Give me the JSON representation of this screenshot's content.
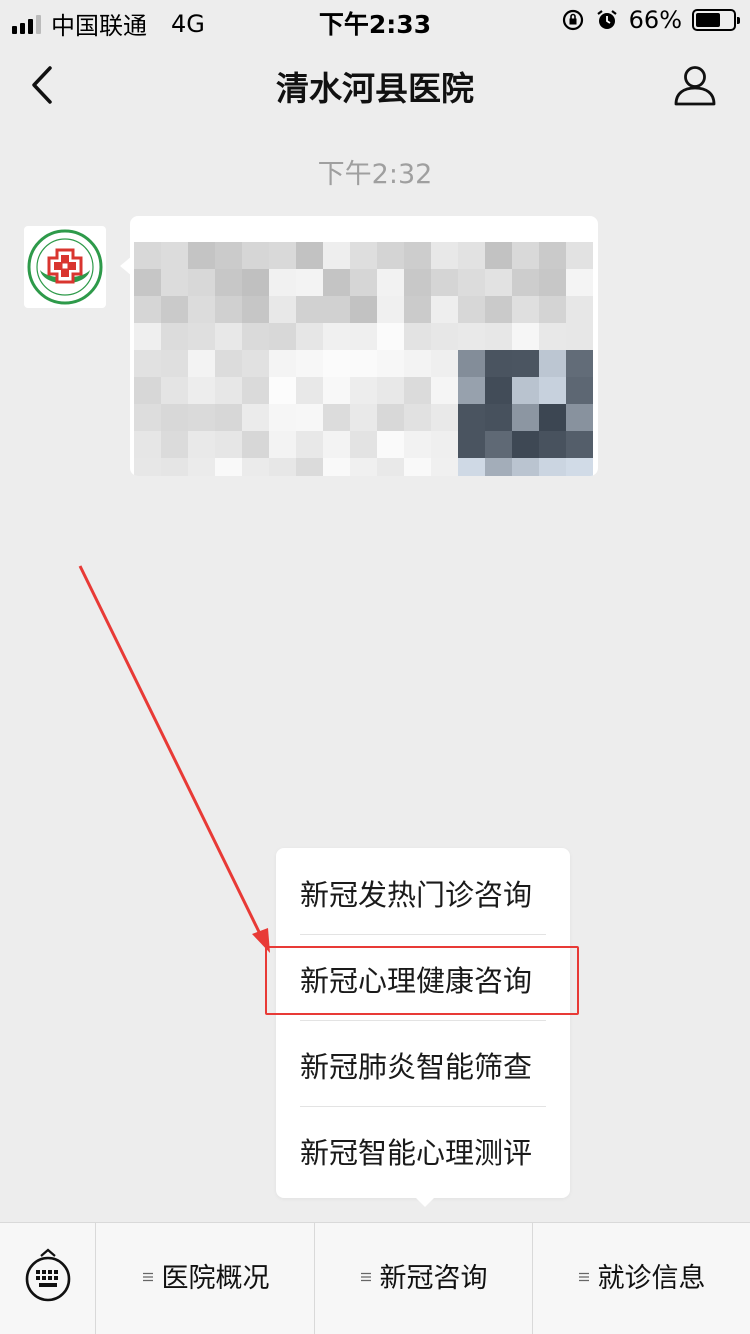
{
  "status_bar": {
    "carrier": "中国联通",
    "network": "4G",
    "time": "下午2:33",
    "battery_percent": "66%",
    "battery_level": 0.66
  },
  "nav": {
    "title": "清水河县医院",
    "back_icon": "chevron-left-icon",
    "profile_icon": "person-icon"
  },
  "chat": {
    "timestamp": "下午2:32"
  },
  "submenu": {
    "items": [
      {
        "label": "新冠发热门诊咨询"
      },
      {
        "label": "新冠心理健康咨询"
      },
      {
        "label": "新冠肺炎智能筛查"
      },
      {
        "label": "新冠智能心理测评"
      }
    ],
    "highlighted_index": 1
  },
  "bottom_menu": {
    "keyboard_icon": "keyboard-icon",
    "tabs": [
      {
        "label": "医院概况"
      },
      {
        "label": "新冠咨询"
      },
      {
        "label": "就诊信息"
      }
    ]
  },
  "colors": {
    "background": "#ededed",
    "annotation_red": "#e83a36",
    "logo_green": "#2e9a4a",
    "logo_red": "#d9352f"
  }
}
